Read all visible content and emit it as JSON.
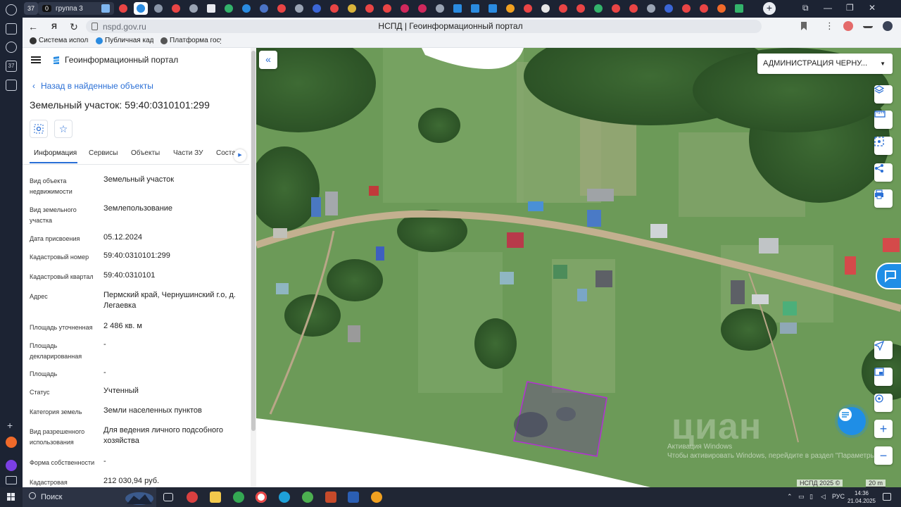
{
  "browser": {
    "tab_group": {
      "count": "0",
      "label": "группа 3"
    },
    "window_tab_badge": "37",
    "url": "nspd.gov.ru",
    "page_title": "НСПД | Геоинформационный портал",
    "bookmarks": [
      {
        "label": "Система исполне",
        "color": "#333333"
      },
      {
        "label": "Публичная када",
        "color": "#2a8be0"
      },
      {
        "label": "Платформа госуд",
        "color": "#555555"
      }
    ],
    "sidebar_badge": "37"
  },
  "panel": {
    "portal_title": "Геоинформационный портал",
    "back_label": "Назад в найденные объекты",
    "object_title": "Земельный участок: 59:40:0310101:299",
    "tabs": [
      "Информация",
      "Сервисы",
      "Объекты",
      "Части ЗУ",
      "Соста"
    ],
    "rows": [
      {
        "label": "Вид объекта недвижимости",
        "value": "Земельный участок"
      },
      {
        "label": "Вид земельного участка",
        "value": "Землепользование"
      },
      {
        "label": "Дата присвоения",
        "value": "05.12.2024"
      },
      {
        "label": "Кадастровый номер",
        "value": "59:40:0310101:299"
      },
      {
        "label": "Кадастровый квартал",
        "value": "59:40:0310101"
      },
      {
        "label": "Адрес",
        "value": "Пермский край, Чернушинский г.о, д. Легаевка"
      },
      {
        "label": "Площадь уточненная",
        "value": "2 486 кв. м"
      },
      {
        "label": "Площадь декларированная",
        "value": "-"
      },
      {
        "label": "Площадь",
        "value": "-"
      },
      {
        "label": "Статус",
        "value": "Учтенный"
      },
      {
        "label": "Категория земель",
        "value": "Земли населенных пунктов"
      },
      {
        "label": "Вид разрешенного использования",
        "value": "Для ведения личного подсобного хозяйства"
      },
      {
        "label": "Форма собственности",
        "value": "-"
      },
      {
        "label": "Кадастровая",
        "value": "212 030,94 руб."
      }
    ]
  },
  "map": {
    "admin_select": "АДМИНИСТРАЦИЯ ЧЕРНУ...",
    "watermark_big": "циан",
    "watermark_line1": "Активация Windows",
    "watermark_line2": "Чтобы активировать Windows, перейдите в раздел \"Параметры\".",
    "copyright": "НСПД 2025 ©",
    "scale": "20 m",
    "parcel_color": "#9b2fc4",
    "tools": [
      "layers-icon",
      "ruler-icon",
      "select-area-icon",
      "share-icon",
      "print-icon"
    ],
    "bottom_tools": [
      "locate-icon",
      "picture-in-picture-icon",
      "gps-icon",
      "zoom-in-icon",
      "zoom-out-icon"
    ]
  },
  "taskbar": {
    "search_label": "Поиск",
    "lang": "РУС",
    "time": "14:36",
    "date": "21.04.2025"
  }
}
